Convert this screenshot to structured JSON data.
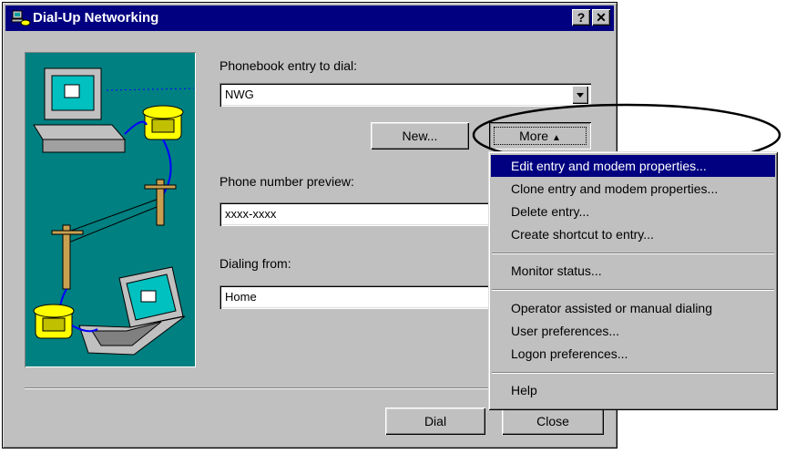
{
  "window": {
    "title": "Dial-Up Networking",
    "help_btn": "?",
    "close_btn": "✕"
  },
  "phonebook": {
    "label": "Phonebook entry to dial:",
    "value": "NWG"
  },
  "buttons": {
    "new": "New...",
    "more": "More",
    "dial": "Dial",
    "close": "Close"
  },
  "phone_preview": {
    "label": "Phone number preview:",
    "value": "xxxx-xxxx"
  },
  "dialing_from": {
    "label": "Dialing from:",
    "value": "Home"
  },
  "menu": {
    "items": [
      "Edit entry and modem properties...",
      "Clone entry and modem properties...",
      "Delete entry...",
      "Create shortcut to entry...",
      "Monitor status...",
      "Operator assisted or manual dialing",
      "User preferences...",
      "Logon preferences...",
      "Help"
    ]
  },
  "colors": {
    "titlebar": "#000080",
    "illustration_bg": "#008080",
    "highlight": "#000080"
  }
}
